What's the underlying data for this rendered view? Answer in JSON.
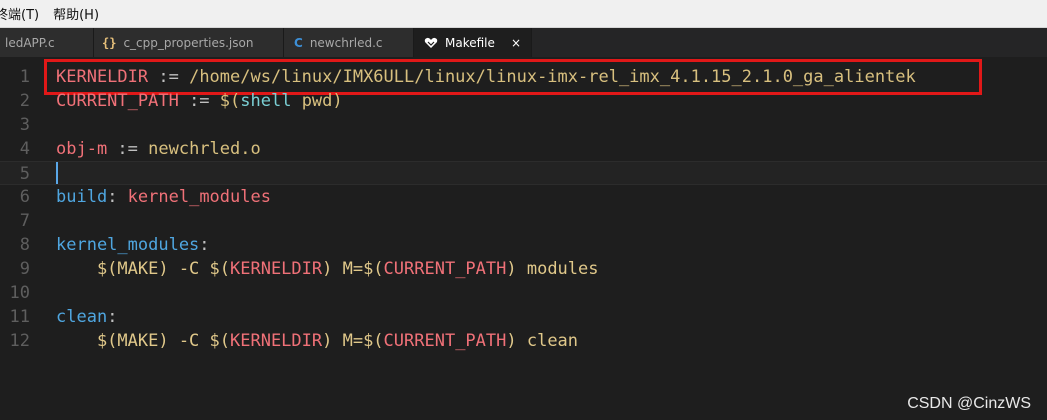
{
  "menubar": {
    "items": [
      {
        "label": "终端(T)"
      },
      {
        "label": "帮助(H)"
      }
    ]
  },
  "tabs": [
    {
      "label": "ledAPP.c",
      "icon": "none"
    },
    {
      "label": "c_cpp_properties.json",
      "icon": "json-braces-icon"
    },
    {
      "label": "newchrled.c",
      "icon": "c-file-icon"
    },
    {
      "label": "Makefile",
      "icon": "makefile-icon",
      "active": true,
      "close": "×"
    }
  ],
  "editor": {
    "line_numbers": [
      "1",
      "2",
      "3",
      "4",
      "5",
      "6",
      "7",
      "8",
      "9",
      "10",
      "11",
      "12"
    ],
    "current_line": 5,
    "lines": [
      [
        {
          "t": "KERNELDIR",
          "c": "var"
        },
        {
          "t": " := ",
          "c": "op"
        },
        {
          "t": "/home/ws/linux/IMX6ULL/linux/linux-imx-rel_imx_4.1.15_2.1.0_ga_alientek",
          "c": "path"
        }
      ],
      [
        {
          "t": "CURRENT_PATH",
          "c": "var"
        },
        {
          "t": " := ",
          "c": "op"
        },
        {
          "t": "$(",
          "c": "path"
        },
        {
          "t": "shell",
          "c": "func"
        },
        {
          "t": " pwd)",
          "c": "path"
        }
      ],
      [],
      [
        {
          "t": "obj-m",
          "c": "var"
        },
        {
          "t": " := ",
          "c": "op"
        },
        {
          "t": "newchrled.o",
          "c": "path"
        }
      ],
      [],
      [
        {
          "t": "build",
          "c": "blue"
        },
        {
          "t": ": ",
          "c": "op"
        },
        {
          "t": "kernel_modules",
          "c": "var"
        }
      ],
      [],
      [
        {
          "t": "kernel_modules",
          "c": "blue"
        },
        {
          "t": ":",
          "c": "op"
        }
      ],
      [
        {
          "t": "    $(MAKE) -C $(",
          "c": "text"
        },
        {
          "t": "KERNELDIR",
          "c": "var"
        },
        {
          "t": ") M=$(",
          "c": "text"
        },
        {
          "t": "CURRENT_PATH",
          "c": "var"
        },
        {
          "t": ") modules",
          "c": "text"
        }
      ],
      [],
      [
        {
          "t": "clean",
          "c": "blue"
        },
        {
          "t": ":",
          "c": "op"
        }
      ],
      [
        {
          "t": "    $(MAKE) -C $(",
          "c": "text"
        },
        {
          "t": "KERNELDIR",
          "c": "var"
        },
        {
          "t": ") M=$(",
          "c": "text"
        },
        {
          "t": "CURRENT_PATH",
          "c": "var"
        },
        {
          "t": ") clean",
          "c": "text"
        }
      ]
    ]
  },
  "watermark": "CSDN @CinzWS",
  "colors": {
    "highlight_box": "#e11818",
    "variable": "#f07178",
    "target": "#4fa6e0",
    "path": "#d8c07f"
  }
}
